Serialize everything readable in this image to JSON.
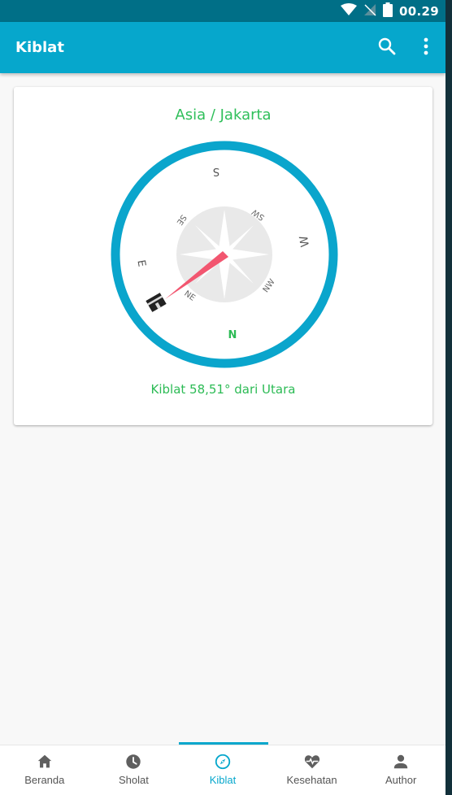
{
  "status_bar": {
    "time": "00.29",
    "icons": [
      "wifi-icon",
      "signal-off-icon",
      "battery-icon"
    ]
  },
  "app_bar": {
    "title": "Kiblat",
    "actions": [
      "search-icon",
      "more-vert-icon"
    ]
  },
  "card": {
    "location": "Asia / Jakarta",
    "compass": {
      "directions": {
        "S": "S",
        "SW": "SW",
        "W": "W",
        "NW": "NW",
        "N": "N",
        "NE": "NE",
        "E": "E",
        "SE": "SE"
      },
      "ring_color": "#0aa5cc",
      "needle_color": "#f25670",
      "north_color": "#2cbb55",
      "qibla_direction_deg": 58.51
    },
    "qibla_text": "Kiblat 58,51° dari Utara"
  },
  "bottom_nav": {
    "items": [
      {
        "label": "Beranda",
        "icon": "home-icon",
        "active": false
      },
      {
        "label": "Sholat",
        "icon": "clock-icon",
        "active": false
      },
      {
        "label": "Kiblat",
        "icon": "compass-icon",
        "active": true
      },
      {
        "label": "Kesehatan",
        "icon": "heart-pulse-icon",
        "active": false
      },
      {
        "label": "Author",
        "icon": "person-icon",
        "active": false
      }
    ]
  },
  "colors": {
    "primary": "#06a7cc",
    "status_bar": "#006f87",
    "accent_green": "#2cbb55"
  }
}
